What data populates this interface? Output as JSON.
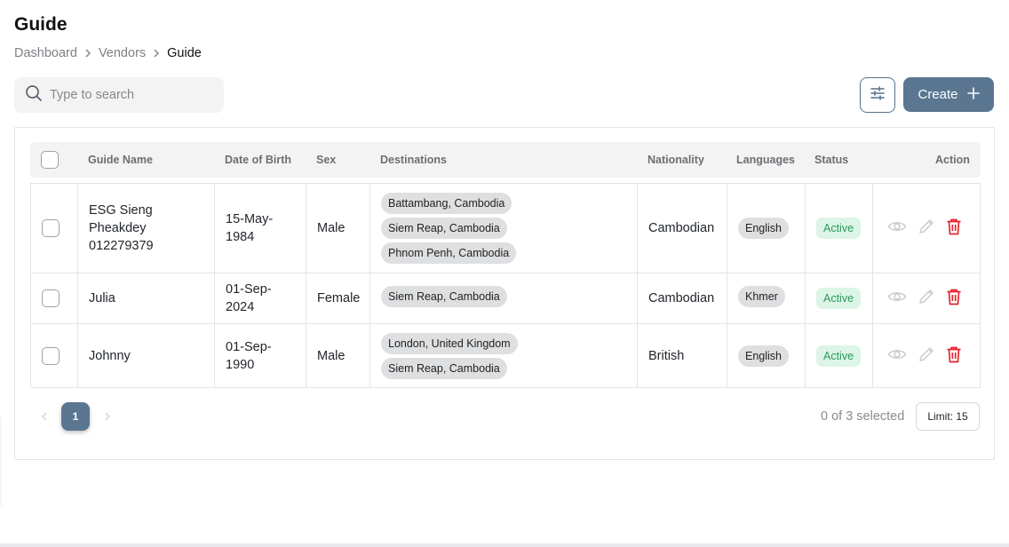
{
  "page": {
    "title": "Guide"
  },
  "breadcrumb": [
    "Dashboard",
    "Vendors",
    "Guide"
  ],
  "search": {
    "placeholder": "Type to search",
    "value": ""
  },
  "toolbar": {
    "create_label": "Create",
    "filter_icon": "sliders-icon",
    "create_icon": "plus-icon"
  },
  "table": {
    "headers": {
      "name": "Guide Name",
      "dob": "Date of Birth",
      "sex": "Sex",
      "destinations": "Destinations",
      "nationality": "Nationality",
      "languages": "Languages",
      "status": "Status",
      "action": "Action"
    },
    "rows": [
      {
        "name_lines": [
          "ESG Sieng",
          "Pheakdey",
          "012279379"
        ],
        "dob_lines": [
          "15-May-",
          "1984"
        ],
        "sex": "Male",
        "destinations": [
          "Battambang, Cambodia",
          "Siem Reap, Cambodia",
          "Phnom Penh, Cambodia"
        ],
        "nationality": "Cambodian",
        "language": "English",
        "status": "Active"
      },
      {
        "name_lines": [
          "Julia"
        ],
        "dob_lines": [
          "01-Sep-",
          "2024"
        ],
        "sex": "Female",
        "destinations": [
          "Siem Reap, Cambodia"
        ],
        "nationality": "Cambodian",
        "language": "Khmer",
        "status": "Active"
      },
      {
        "name_lines": [
          "Johnny"
        ],
        "dob_lines": [
          "01-Sep-",
          "1990"
        ],
        "sex": "Male",
        "destinations": [
          "London, United Kingdom",
          "Siem Reap, Cambodia"
        ],
        "nationality": "British",
        "language": "English",
        "status": "Active"
      }
    ]
  },
  "pagination": {
    "current_page": "1",
    "selected_text": "0 of 3 selected",
    "limit_label": "Limit: 15"
  },
  "colors": {
    "primary": "#5a7691",
    "danger": "#e5232c",
    "active_bg": "#dcf5e6",
    "active_text": "#2b9a5a"
  }
}
